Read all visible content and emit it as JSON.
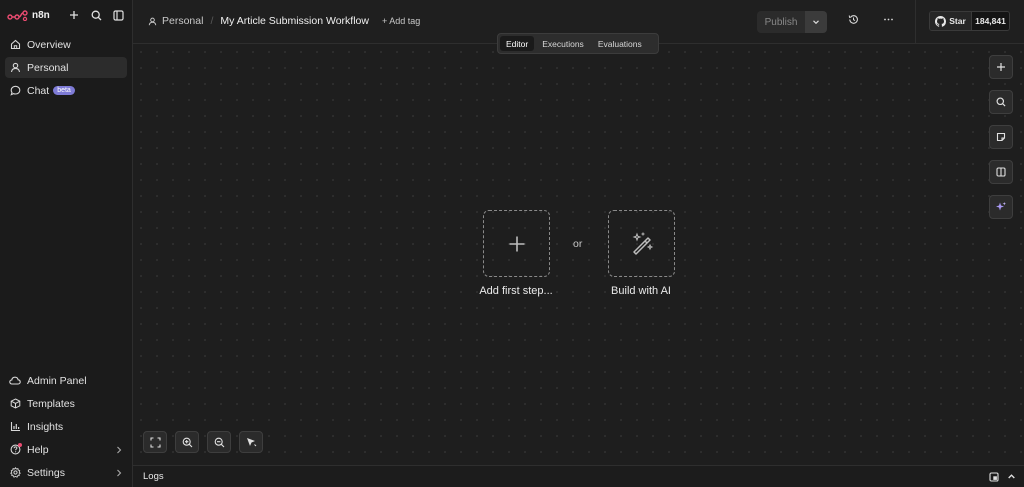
{
  "brand": {
    "name": "n8n",
    "accent": "#ea4b71"
  },
  "sidebar": {
    "top": [
      {
        "label": "Overview",
        "icon": "home-icon"
      },
      {
        "label": "Personal",
        "icon": "user-icon"
      },
      {
        "label": "Chat",
        "icon": "chat-icon",
        "badge": "beta"
      }
    ],
    "bottom": [
      {
        "label": "Admin Panel",
        "icon": "cloud-icon"
      },
      {
        "label": "Templates",
        "icon": "box-icon"
      },
      {
        "label": "Insights",
        "icon": "chart-icon"
      },
      {
        "label": "Help",
        "icon": "help-icon"
      },
      {
        "label": "Settings",
        "icon": "gear-icon"
      }
    ]
  },
  "header": {
    "breadcrumb_parent": "Personal",
    "breadcrumb_separator": "/",
    "workflow_title": "My Article Submission Workflow",
    "add_tag": "+ Add tag",
    "publish_label": "Publish",
    "github_star": "Star",
    "github_count": "184,841"
  },
  "tabs": [
    {
      "label": "Editor",
      "active": true
    },
    {
      "label": "Executions",
      "active": false
    },
    {
      "label": "Evaluations",
      "active": false
    }
  ],
  "canvas": {
    "add_first_step": "Add first step...",
    "or": "or",
    "build_with_ai": "Build with AI"
  },
  "logs": {
    "label": "Logs"
  }
}
